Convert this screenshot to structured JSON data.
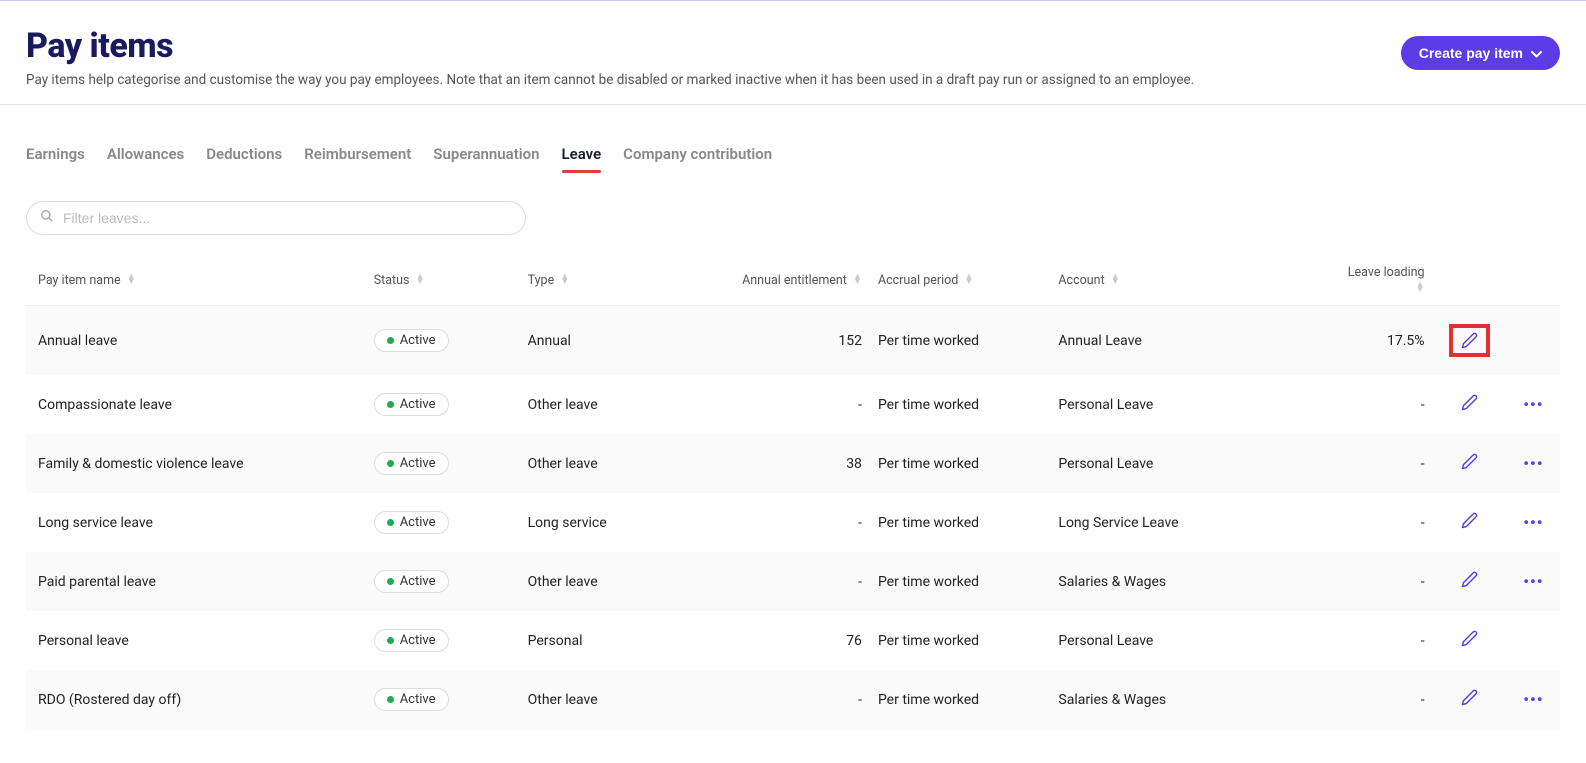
{
  "header": {
    "title": "Pay items",
    "subtitle": "Pay items help categorise and customise the way you pay employees. Note that an item cannot be disabled or marked inactive when it has been used in a draft pay run or assigned to an employee.",
    "create_button": "Create pay item"
  },
  "tabs": [
    {
      "label": "Earnings",
      "active": false
    },
    {
      "label": "Allowances",
      "active": false
    },
    {
      "label": "Deductions",
      "active": false
    },
    {
      "label": "Reimbursement",
      "active": false
    },
    {
      "label": "Superannuation",
      "active": false
    },
    {
      "label": "Leave",
      "active": true
    },
    {
      "label": "Company contribution",
      "active": false
    }
  ],
  "filter": {
    "placeholder": "Filter leaves..."
  },
  "columns": {
    "name": "Pay item name",
    "status": "Status",
    "type": "Type",
    "entitlement": "Annual entitlement",
    "accrual": "Accrual period",
    "account": "Account",
    "loading": "Leave loading"
  },
  "status_label": "Active",
  "rows": [
    {
      "name": "Annual leave",
      "status": "Active",
      "type": "Annual",
      "entitlement": "152",
      "accrual": "Per time worked",
      "account": "Annual Leave",
      "loading": "17.5%",
      "highlight": true,
      "showMore": false
    },
    {
      "name": "Compassionate leave",
      "status": "Active",
      "type": "Other leave",
      "entitlement": "-",
      "accrual": "Per time worked",
      "account": "Personal Leave",
      "loading": "-",
      "highlight": false,
      "showMore": true
    },
    {
      "name": "Family & domestic violence leave",
      "status": "Active",
      "type": "Other leave",
      "entitlement": "38",
      "accrual": "Per time worked",
      "account": "Personal Leave",
      "loading": "-",
      "highlight": false,
      "showMore": true
    },
    {
      "name": "Long service leave",
      "status": "Active",
      "type": "Long service",
      "entitlement": "-",
      "accrual": "Per time worked",
      "account": "Long Service Leave",
      "loading": "-",
      "highlight": false,
      "showMore": true
    },
    {
      "name": "Paid parental leave",
      "status": "Active",
      "type": "Other leave",
      "entitlement": "-",
      "accrual": "Per time worked",
      "account": "Salaries & Wages",
      "loading": "-",
      "highlight": false,
      "showMore": true
    },
    {
      "name": "Personal leave",
      "status": "Active",
      "type": "Personal",
      "entitlement": "76",
      "accrual": "Per time worked",
      "account": "Personal Leave",
      "loading": "-",
      "highlight": false,
      "showMore": false
    },
    {
      "name": "RDO (Rostered day off)",
      "status": "Active",
      "type": "Other leave",
      "entitlement": "-",
      "accrual": "Per time worked",
      "account": "Salaries & Wages",
      "loading": "-",
      "highlight": false,
      "showMore": true
    }
  ]
}
